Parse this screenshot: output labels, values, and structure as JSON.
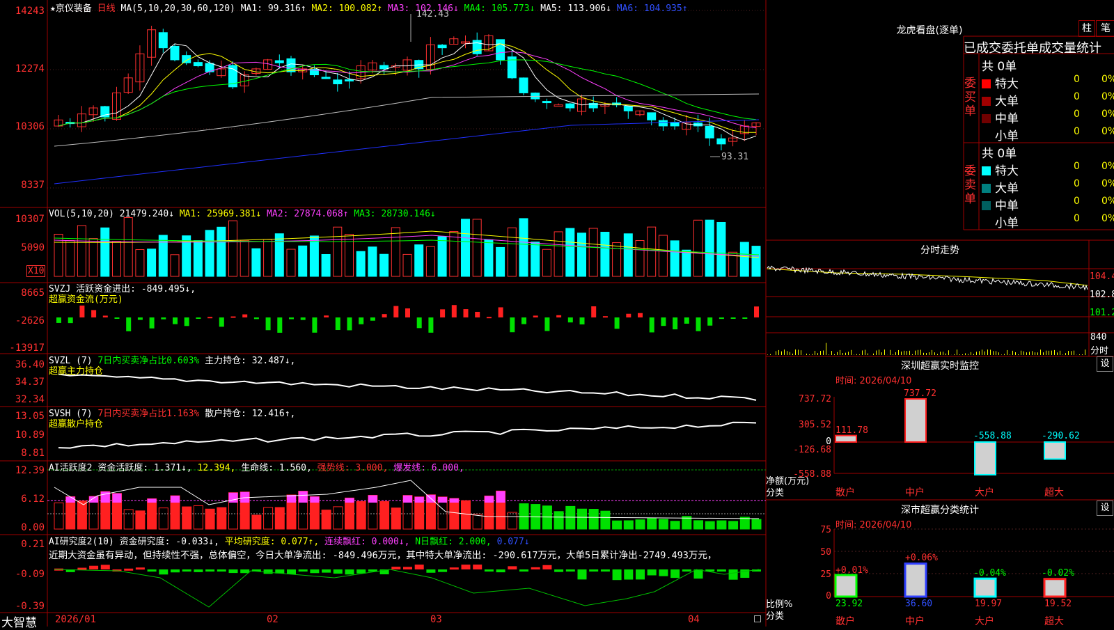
{
  "stock": {
    "name": "京仪装备",
    "period": "日线",
    "star": "★"
  },
  "ma_header": {
    "label": "MA(5,10,20,30,60,120)",
    "ma1": "MA1: 99.316↑",
    "ma2": "MA2: 100.082↑",
    "ma3": "MA3: 102.146↓",
    "ma4": "MA4: 105.773↓",
    "ma5": "MA5: 113.906↓",
    "ma6": "MA6: 104.935↑"
  },
  "price_axis": [
    "14243",
    "12274",
    "10306",
    "8337"
  ],
  "price_annot": {
    "high": "142.43",
    "low": "93.31"
  },
  "vol_header": {
    "label": "VOL(5,10,20)",
    "v": "21479.240↓",
    "ma1": "MA1: 25969.381↓",
    "ma2": "MA2: 27874.068↑",
    "ma3": "MA3: 28730.146↓"
  },
  "vol_axis": [
    "10307",
    "5090"
  ],
  "vol_unit": "X10",
  "svzj_header": {
    "label": "SVZJ",
    "desc": "活跃资金进出: -849.495↓,",
    "sub": "超赢资金流(万元)"
  },
  "svzj_axis": [
    "8665",
    "-2626",
    "-13917"
  ],
  "svzl_header": {
    "label": "SVZL (7)",
    "desc": "7日内买卖净占比0.603%",
    "desc2": "主力持仓: 32.487↓,",
    "sub": "超赢主力持仓"
  },
  "svzl_axis": [
    "36.40",
    "34.37",
    "32.34"
  ],
  "svsh_header": {
    "label": "SVSH (7)",
    "desc": "7日内买卖净占比1.163%",
    "desc2": "散户持仓: 12.416↑,",
    "sub": "超赢散户持仓"
  },
  "svsh_axis": [
    "13.05",
    "10.89",
    "8.81"
  ],
  "ai1_header": {
    "label": "AI活跃度2",
    "a": "资金活跃度: 1.371↓,",
    "b": "12.394,",
    "c": "生命线: 1.560,",
    "d": "强势线: 3.000,",
    "e": "爆发线: 6.000,"
  },
  "ai1_axis": [
    "12.39",
    "6.12",
    "0.00"
  ],
  "ai2_header": {
    "label": "AI研究度2(10)",
    "a": "资金研究度: -0.033↓,",
    "b": "平均研究度: 0.077↑,",
    "c": "连续飘红: 0.000↓,",
    "d": "N日飘红: 2.000,",
    "e": "0.077↓"
  },
  "ai2_text": "近期大资金虽有异动，但持续性不强，总体偏空，今日大单净流出: -849.496万元，其中特大单净流出: -290.617万元，大单5日累计净出-2749.493万元，",
  "ai2_axis": [
    "0.21",
    "-0.09",
    "-0.39"
  ],
  "x_axis": {
    "brand": "大智慧",
    "labels": [
      "2026/01",
      "02",
      "03",
      "04"
    ]
  },
  "longhu": {
    "title": "龙虎看盘(逐单)",
    "btn_bar": "柱",
    "btn_pen": "笔",
    "tab_title": "已成交委托单成交量统计",
    "buy": {
      "side": "委买单",
      "total": "共 0单",
      "rows": [
        {
          "label": "特大",
          "color": "#ff0000",
          "v": "0",
          "p": "0%"
        },
        {
          "label": "大单",
          "color": "#a00000",
          "v": "0",
          "p": "0%"
        },
        {
          "label": "中单",
          "color": "#700000",
          "v": "0",
          "p": "0%"
        },
        {
          "label": "小单",
          "color": "#000000",
          "v": "0",
          "p": "0%"
        }
      ]
    },
    "sell": {
      "side": "委卖单",
      "total": "共 0单",
      "rows": [
        {
          "label": "特大",
          "color": "#00ffff",
          "v": "0",
          "p": "0%"
        },
        {
          "label": "大单",
          "color": "#008080",
          "v": "0",
          "p": "0%"
        },
        {
          "label": "中单",
          "color": "#006060",
          "v": "0",
          "p": "0%"
        },
        {
          "label": "小单",
          "color": "#000000",
          "v": "0",
          "p": "0%"
        }
      ]
    }
  },
  "intraday": {
    "title": "分时走势",
    "axis": [
      "104.4",
      "102.8",
      "101.2",
      "840"
    ],
    "unit": "分时"
  },
  "monitor": {
    "title": "深圳超赢实时监控",
    "btn": "设",
    "time": "时间: 2026/04/10",
    "axis": [
      "737.72",
      "305.52",
      "0",
      "-126.68",
      "-558.88"
    ],
    "ylabel": "净额(万元)",
    "xlabel": "分类",
    "chart_data": {
      "type": "bar",
      "categories": [
        "散户",
        "中户",
        "大户",
        "超大"
      ],
      "values": [
        111.78,
        737.72,
        -558.88,
        -290.62
      ],
      "ylim": [
        -558.88,
        737.72
      ]
    },
    "labels": [
      "111.78",
      "737.72",
      "-558.88",
      "-290.62"
    ]
  },
  "classify": {
    "title": "深市超赢分类统计",
    "btn": "设",
    "time": "时间: 2026/04/10",
    "axis": [
      "75",
      "50",
      "25",
      "0"
    ],
    "ylabel": "比例%",
    "xlabel": "分类",
    "chart_data": {
      "type": "bar",
      "categories": [
        "散户",
        "中户",
        "大户",
        "超大"
      ],
      "values": [
        23.92,
        36.6,
        19.97,
        19.52
      ],
      "changes": [
        "+0.01%",
        "+0.06%",
        "-0.04%",
        "-0.02%"
      ],
      "ylim": [
        0,
        75
      ]
    },
    "values_text": [
      "23.92",
      "36.60",
      "19.97",
      "19.52"
    ]
  }
}
